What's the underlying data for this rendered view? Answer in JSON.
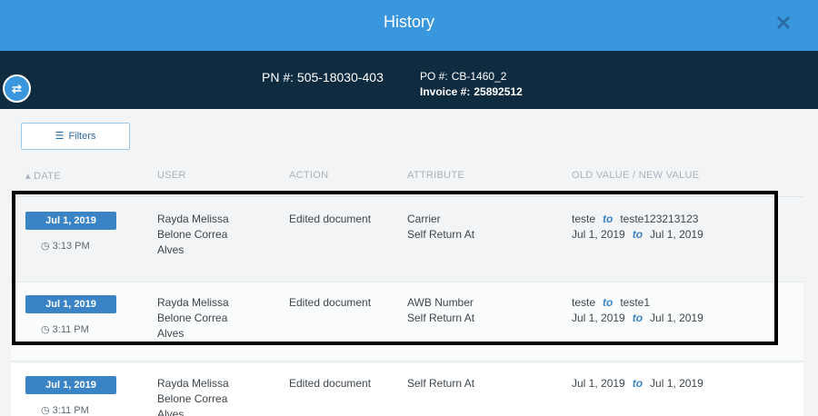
{
  "header": {
    "title": "History",
    "close_glyph": "✕"
  },
  "info": {
    "pn_label": "PN #:",
    "pn_value": "505-18030-403",
    "po_label": "PO #:",
    "po_value": "CB-1460_2",
    "invoice_label": "Invoice #:",
    "invoice_value": "25892512",
    "swap_icon": "⇄"
  },
  "filters": {
    "label": "Filters",
    "icon": "sliders-icon"
  },
  "columns": {
    "date": "▴ DATE",
    "user": "USER",
    "action": "ACTION",
    "attribute": "ATTRIBUTE",
    "values": "OLD VALUE / NEW VALUE"
  },
  "to_label": "to",
  "rows": [
    {
      "date": "Jul 1, 2019",
      "time": "3:13 PM",
      "user": [
        "Rayda Melissa",
        "Belone Correa",
        "Alves"
      ],
      "action": "Edited document",
      "changes": [
        {
          "attribute": "Carrier",
          "old": "teste",
          "new": "teste123213123"
        },
        {
          "attribute": "Self Return At",
          "old": "Jul 1, 2019",
          "new": "Jul 1, 2019"
        }
      ]
    },
    {
      "date": "Jul 1, 2019",
      "time": "3:11 PM",
      "user": [
        "Rayda Melissa",
        "Belone Correa",
        "Alves"
      ],
      "action": "Edited document",
      "changes": [
        {
          "attribute": "AWB Number",
          "old": "teste",
          "new": "teste1"
        },
        {
          "attribute": "Self Return At",
          "old": "Jul 1, 2019",
          "new": "Jul 1, 2019"
        }
      ]
    },
    {
      "date": "Jul 1, 2019",
      "time": "3:11 PM",
      "user": [
        "Rayda Melissa",
        "Belone Correa",
        "Alves"
      ],
      "action": "Edited document",
      "changes": [
        {
          "attribute": "Self Return At",
          "old": "Jul 1, 2019",
          "new": "Jul 1, 2019"
        }
      ]
    }
  ]
}
